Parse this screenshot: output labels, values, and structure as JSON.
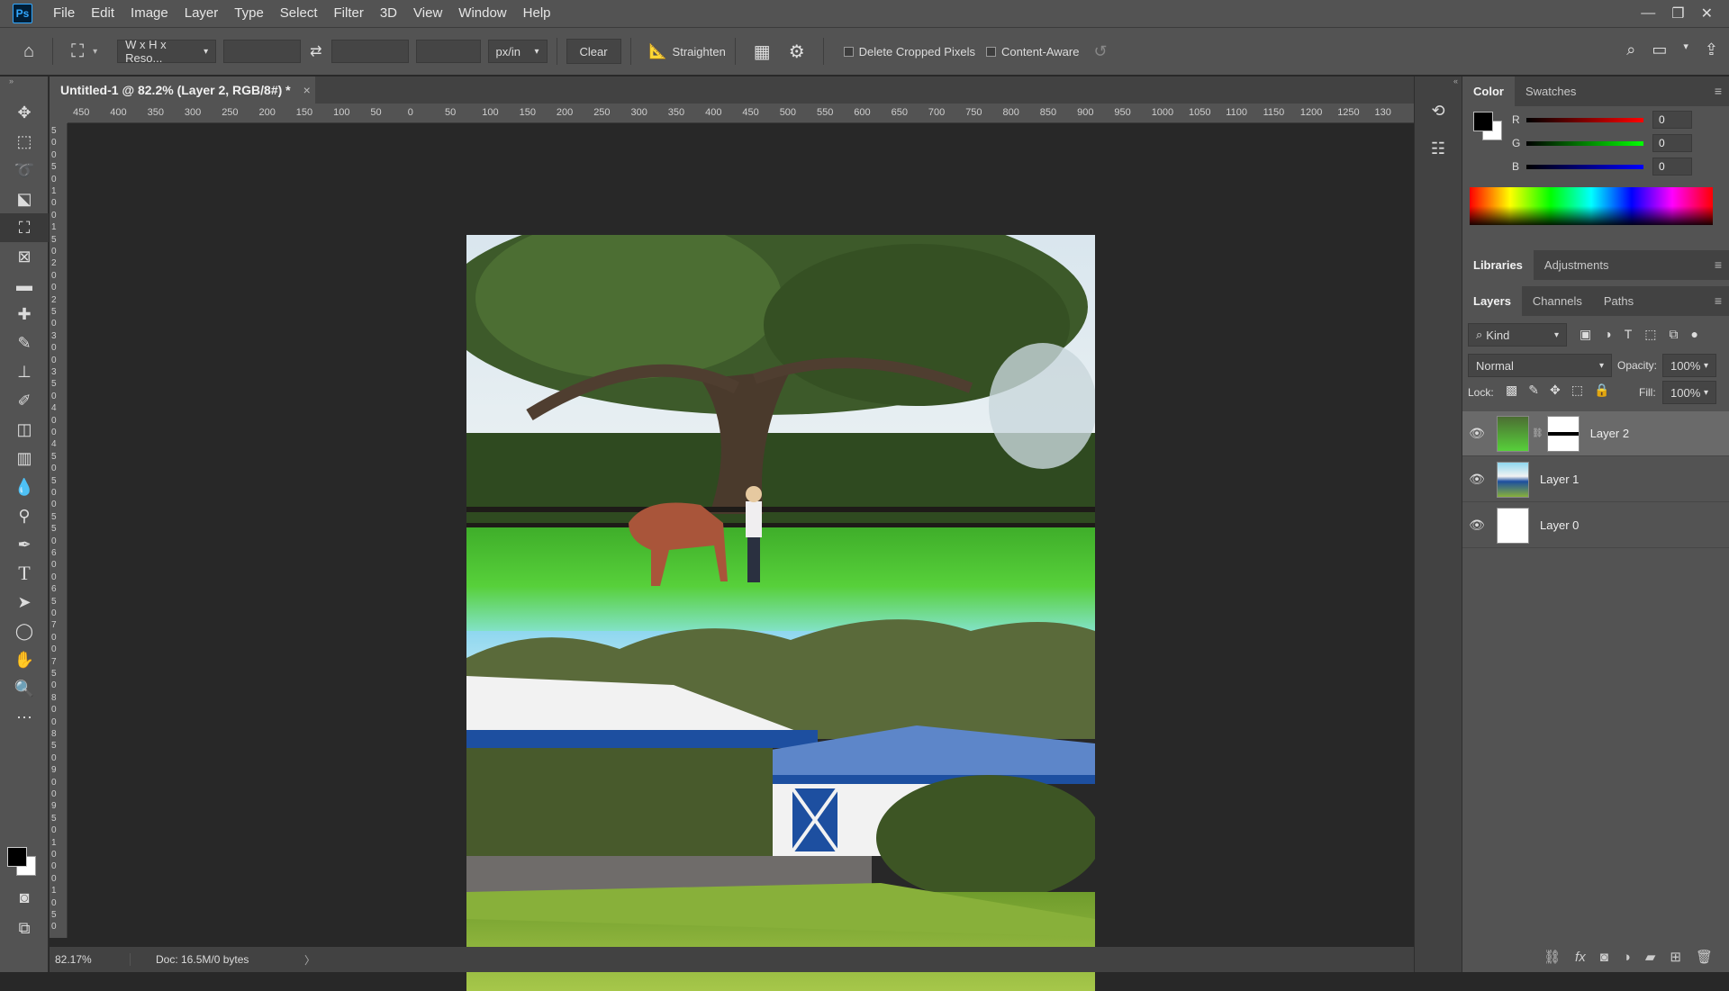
{
  "app": {
    "logo": "Ps"
  },
  "menu": [
    "File",
    "Edit",
    "Image",
    "Layer",
    "Type",
    "Select",
    "Filter",
    "3D",
    "View",
    "Window",
    "Help"
  ],
  "options": {
    "ratio_dropdown": "W x H x Reso...",
    "unit_dropdown": "px/in",
    "clear": "Clear",
    "straighten": "Straighten",
    "delete_cropped": "Delete Cropped Pixels",
    "content_aware": "Content-Aware"
  },
  "document": {
    "tab_title": "Untitled-1 @ 82.2% (Layer 2, RGB/8#) *",
    "close": "×",
    "zoom": "82.17%",
    "doc_info": "Doc: 16.5M/0 bytes",
    "arrow": "〉"
  },
  "ruler_h": [
    "450",
    "400",
    "350",
    "300",
    "250",
    "200",
    "150",
    "100",
    "50",
    "0",
    "50",
    "100",
    "150",
    "200",
    "250",
    "300",
    "350",
    "400",
    "450",
    "500",
    "550",
    "600",
    "650",
    "700",
    "750",
    "800",
    "850",
    "900",
    "950",
    "1000",
    "1050",
    "1100",
    "1150",
    "1200",
    "1250",
    "130"
  ],
  "ruler_v": [
    "5",
    "0",
    "0",
    "5",
    "0",
    "1",
    "0",
    "0",
    "1",
    "5",
    "0",
    "2",
    "0",
    "0",
    "2",
    "5",
    "0",
    "3",
    "0",
    "0",
    "3",
    "5",
    "0",
    "4",
    "0",
    "0",
    "4",
    "5",
    "0",
    "5",
    "0",
    "0",
    "5",
    "5",
    "0",
    "6",
    "0",
    "0",
    "6",
    "5",
    "0",
    "7",
    "0",
    "0",
    "7",
    "5",
    "0",
    "8",
    "0",
    "0",
    "8",
    "5",
    "0",
    "9",
    "0",
    "0",
    "9",
    "5",
    "0",
    "1",
    "0",
    "0",
    "0",
    "1",
    "0",
    "5",
    "0"
  ],
  "color_panel": {
    "tabs": [
      "Color",
      "Swatches"
    ],
    "r_label": "R",
    "g_label": "G",
    "b_label": "B",
    "r": "0",
    "g": "0",
    "b": "0"
  },
  "libraries_panel": {
    "tabs": [
      "Libraries",
      "Adjustments"
    ]
  },
  "layers_panel": {
    "tabs": [
      "Layers",
      "Channels",
      "Paths"
    ],
    "kind": "Kind",
    "blend_mode": "Normal",
    "opacity_label": "Opacity:",
    "opacity": "100%",
    "lock_label": "Lock:",
    "fill_label": "Fill:",
    "fill": "100%",
    "layers": [
      {
        "name": "Layer 2",
        "selected": true
      },
      {
        "name": "Layer 1",
        "selected": false
      },
      {
        "name": "Layer 0",
        "selected": false
      }
    ]
  },
  "colors": {
    "ui_dark": "#535353",
    "ui_darker": "#424242",
    "canvas": "#282828",
    "accent": "#31a8ff"
  }
}
